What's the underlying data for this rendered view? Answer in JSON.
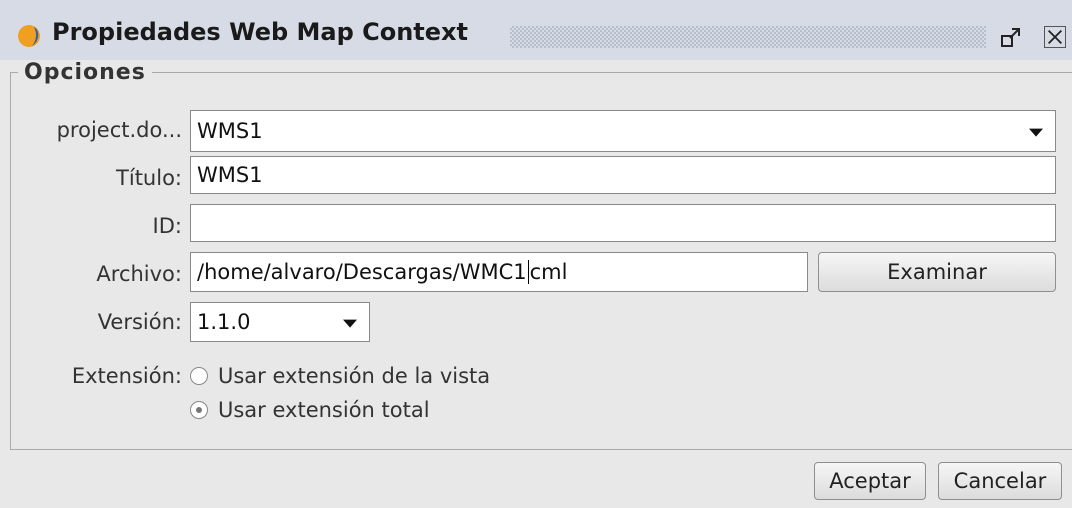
{
  "window": {
    "title": "Propiedades Web Map Context"
  },
  "group": {
    "title": "Opciones"
  },
  "form": {
    "project_label": "project.do...",
    "project_value": "WMS1",
    "title_label": "Título:",
    "title_value": "WMS1",
    "id_label": "ID:",
    "id_value": "",
    "file_label": "Archivo:",
    "file_value_before_caret": "/home/alvaro/Descargas/WMC1",
    "file_value_after_caret": "cml",
    "browse_label": "Examinar",
    "version_label": "Versión:",
    "version_value": "1.1.0",
    "extent_label": "Extensión:",
    "extent_options": [
      {
        "label": "Usar extensión de la vista",
        "checked": false
      },
      {
        "label": "Usar extensión total",
        "checked": true
      }
    ]
  },
  "footer": {
    "accept_label": "Aceptar",
    "cancel_label": "Cancelar"
  },
  "icons": {
    "app": "app-logo-icon",
    "restore": "restore-window-icon",
    "close": "close-window-icon"
  },
  "colors": {
    "titlebar": "#d6dbe6",
    "background": "#e8e8e8",
    "app_icon_orange": "#f0a020",
    "app_icon_blue": "#2f5fb0"
  }
}
